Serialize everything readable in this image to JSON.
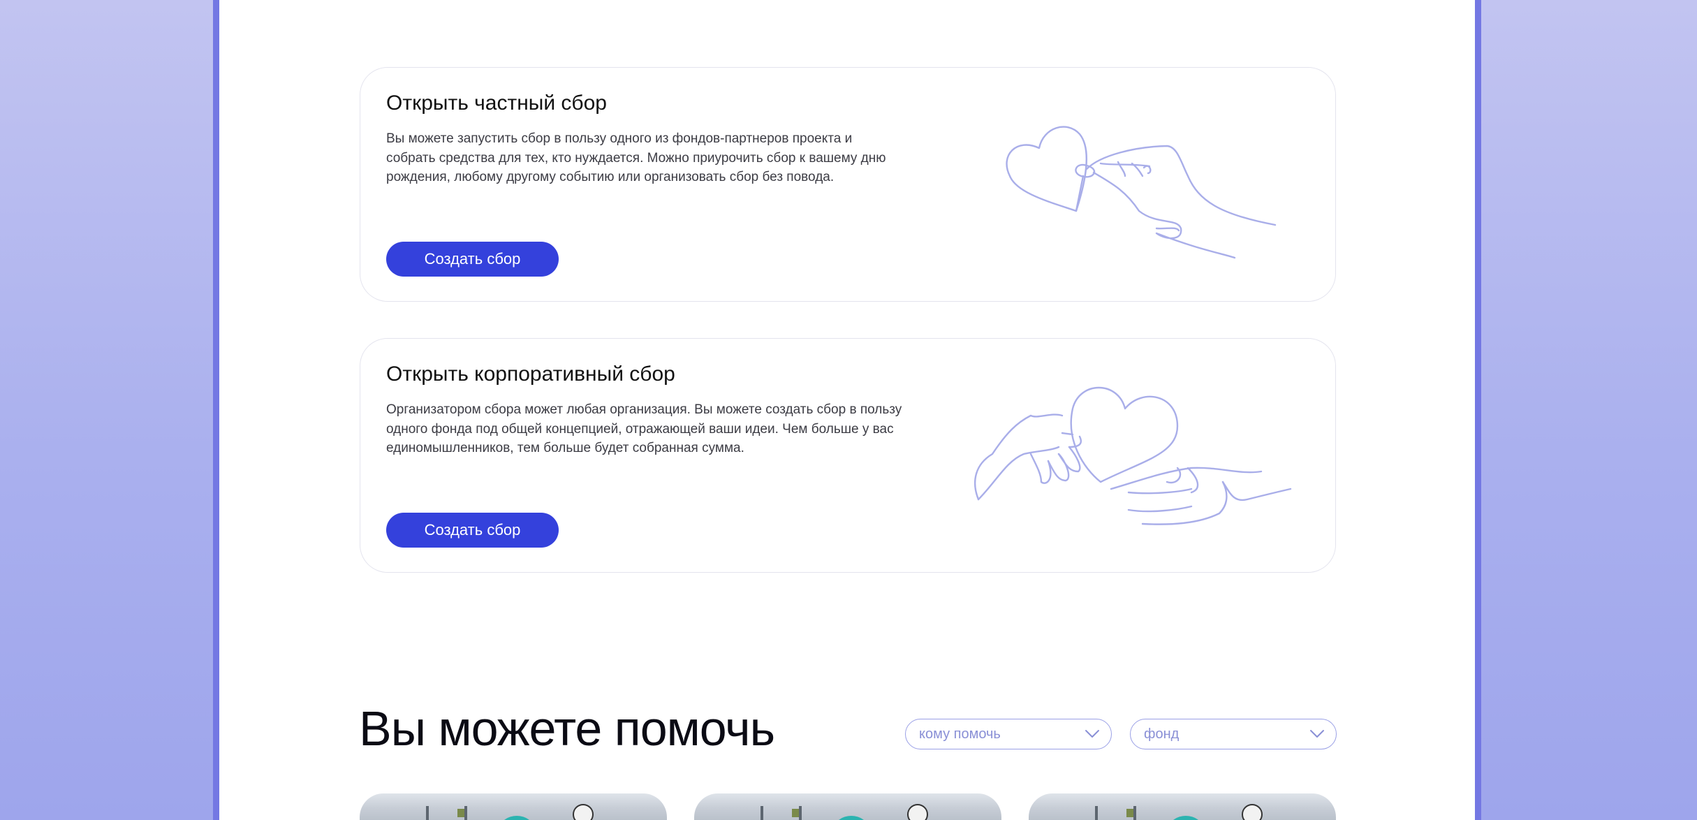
{
  "cards": [
    {
      "title": "Открыть частный сбор",
      "text": "Вы можете запустить сбор в пользу одного из фондов-партнеров проекта и собрать средства для тех, кто нуждается. Можно приурочить сбор к вашему дню рождения, любому другому событию или организовать сбор без повода.",
      "button_label": "Создать сбор",
      "illustration": "hand-holding-heart-icon"
    },
    {
      "title": "Открыть корпоративный сбор",
      "text": "Организатором сбора может любая организация. Вы можете создать сбор в пользу одного фонда под общей концепцией, отражающей ваши идеи. Чем больше у вас единомышленников, тем больше будет собранная сумма.",
      "button_label": "Создать сбор",
      "illustration": "two-hands-heart-icon"
    }
  ],
  "help_section": {
    "title": "Вы можете помочь",
    "filters": [
      {
        "placeholder": "кому помочь",
        "icon": "chevron-down-icon"
      },
      {
        "placeholder": "фонд",
        "icon": "chevron-down-icon"
      }
    ]
  },
  "colors": {
    "accent": "#3441dc",
    "line_art": "#a9aee9",
    "background": "#b8bcef"
  }
}
